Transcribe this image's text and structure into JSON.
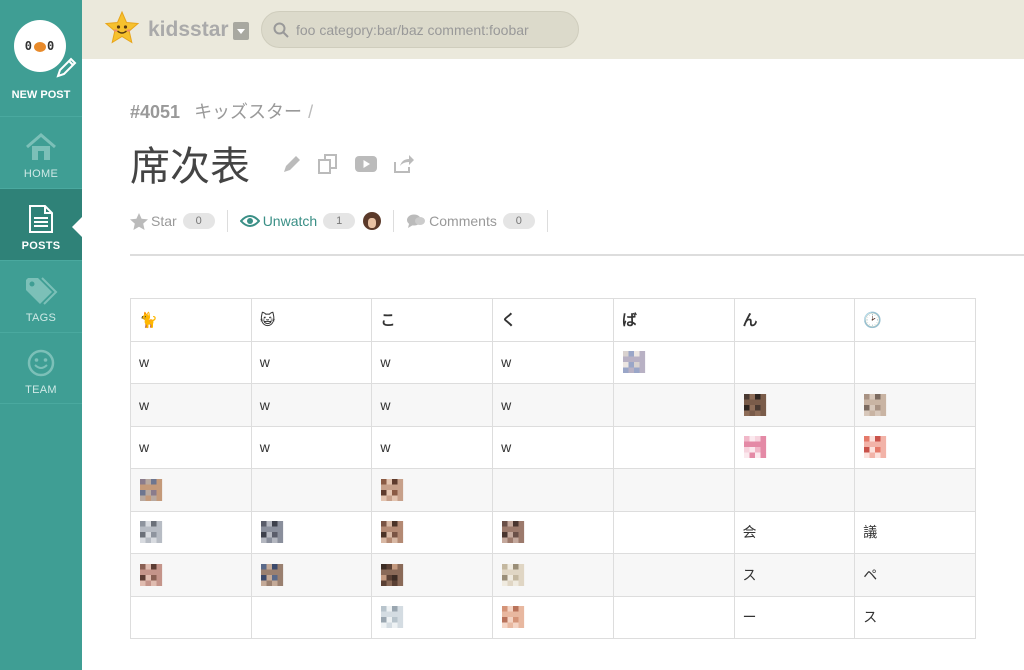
{
  "sidebar": {
    "new_post_label": "NEW POST",
    "avatar_text_left": "0",
    "avatar_text_right": "0",
    "items": [
      {
        "label": "HOME",
        "icon": "home-icon"
      },
      {
        "label": "POSTS",
        "icon": "document-icon",
        "active": true
      },
      {
        "label": "TAGS",
        "icon": "tags-icon"
      },
      {
        "label": "TEAM",
        "icon": "smiley-icon"
      }
    ]
  },
  "header": {
    "team_name": "kidsstar",
    "search_placeholder": "foo category:bar/baz comment:foobar"
  },
  "post": {
    "number": "#4051",
    "category": "キッズスター",
    "separator": "/",
    "title": "席次表",
    "star_label": "Star",
    "star_count": "0",
    "watch_label": "Unwatch",
    "watch_count": "1",
    "comments_label": "Comments",
    "comments_count": "0"
  },
  "table": {
    "headers": [
      "🐈",
      "😺",
      "こ",
      "く",
      "ば",
      "ん",
      "🕑"
    ],
    "rows": [
      [
        {
          "t": "w"
        },
        {
          "t": "w"
        },
        {
          "t": "w"
        },
        {
          "t": "w"
        },
        {
          "img": "face-a"
        },
        {
          "t": ""
        },
        {
          "t": ""
        }
      ],
      [
        {
          "t": "w"
        },
        {
          "t": "w"
        },
        {
          "t": "w"
        },
        {
          "t": "w"
        },
        {
          "t": ""
        },
        {
          "img": "face-b"
        },
        {
          "img": "face-c"
        }
      ],
      [
        {
          "t": "w"
        },
        {
          "t": "w"
        },
        {
          "t": "w"
        },
        {
          "t": "w"
        },
        {
          "t": ""
        },
        {
          "img": "face-d"
        },
        {
          "img": "face-e"
        }
      ],
      [
        {
          "img": "face-f"
        },
        {
          "t": ""
        },
        {
          "img": "face-g"
        },
        {
          "t": ""
        },
        {
          "t": ""
        },
        {
          "t": ""
        },
        {
          "t": ""
        }
      ],
      [
        {
          "img": "face-h"
        },
        {
          "img": "face-i"
        },
        {
          "img": "face-j"
        },
        {
          "img": "face-k"
        },
        {
          "t": ""
        },
        {
          "t": "会"
        },
        {
          "t": "議"
        }
      ],
      [
        {
          "img": "face-l"
        },
        {
          "img": "face-m"
        },
        {
          "img": "face-n"
        },
        {
          "img": "face-o"
        },
        {
          "t": ""
        },
        {
          "t": "ス"
        },
        {
          "t": "ペ"
        }
      ],
      [
        {
          "t": ""
        },
        {
          "t": ""
        },
        {
          "img": "face-p"
        },
        {
          "img": "face-q"
        },
        {
          "t": ""
        },
        {
          "t": "ー"
        },
        {
          "t": "ス"
        }
      ]
    ]
  },
  "colors": {
    "sidebar": "#3f9e94",
    "sidebar_active": "#2f8278",
    "topbar": "#ebe9dc",
    "accent": "#3a8f86"
  }
}
